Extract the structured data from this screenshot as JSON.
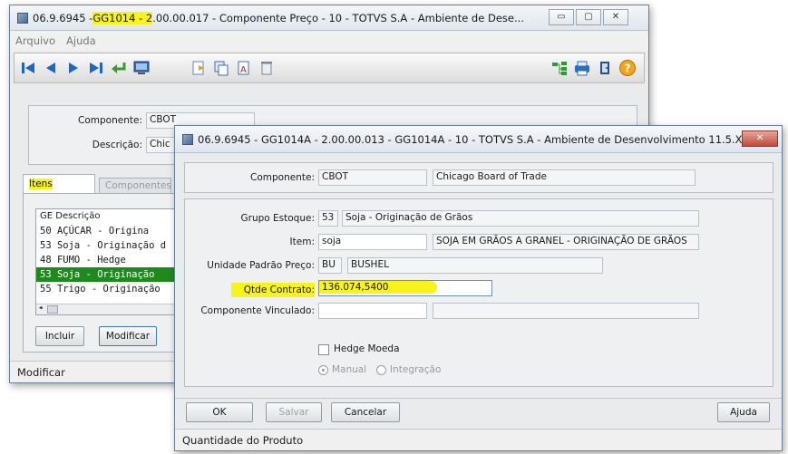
{
  "back_window": {
    "title_pre": "06.9.6945 - ",
    "title_hl": "GG1014 - 2",
    "title_post": ".00.00.017 - Componente Preço - 10 - TOTVS S.A - Ambiente de Dese...",
    "menu": [
      "Arquivo",
      "Ajuda"
    ],
    "componente_label": "Componente:",
    "componente_value": "CBOT",
    "descricao_label": "Descrição:",
    "descricao_value": "Chic",
    "tabs": [
      "Itens",
      "Componentes"
    ],
    "list_header": "GE Descrição",
    "list_rows": [
      "50 AÇÚCAR - Origina",
      "53 Soja - Originação d",
      "48 FUMO - Hedge",
      "53 Soja - Originação",
      "55 Trigo - Originação"
    ],
    "incluir": "Incluir",
    "modificar": "Modificar",
    "status": "Modificar"
  },
  "front_window": {
    "title": "06.9.6945 - GG1014A - 2.00.00.013 - GG1014A - 10 - TOTVS S.A - Ambiente de Desenvolvimento 11.5.X ...",
    "componente_label": "Componente:",
    "componente_code": "CBOT",
    "componente_desc": "Chicago Board of Trade",
    "grupo_label": "Grupo Estoque:",
    "grupo_code": "53",
    "grupo_desc": "Soja - Originação de Grãos",
    "item_label": "Item:",
    "item_code": "soja",
    "item_desc": "SOJA EM GRÃOS A GRANEL - ORIGINAÇÃO DE GRÃOS",
    "unidade_label": "Unidade Padrão Preço:",
    "unidade_code": "BU",
    "unidade_desc": "BUSHEL",
    "qtde_label": "Qtde Contrato:",
    "qtde_value": "136.074,5400",
    "vinculado_label": "Componente Vinculado:",
    "vinculado_code": "",
    "vinculado_desc": "",
    "hedge_label": "Hedge Moeda",
    "radio_manual": "Manual",
    "radio_integracao": "Integração",
    "ok": "OK",
    "salvar": "Salvar",
    "cancelar": "Cancelar",
    "ajuda": "Ajuda",
    "status": "Quantidade do Produto"
  },
  "colors": {
    "highlight": "#f7f31b",
    "selection": "#1e8a1e"
  }
}
